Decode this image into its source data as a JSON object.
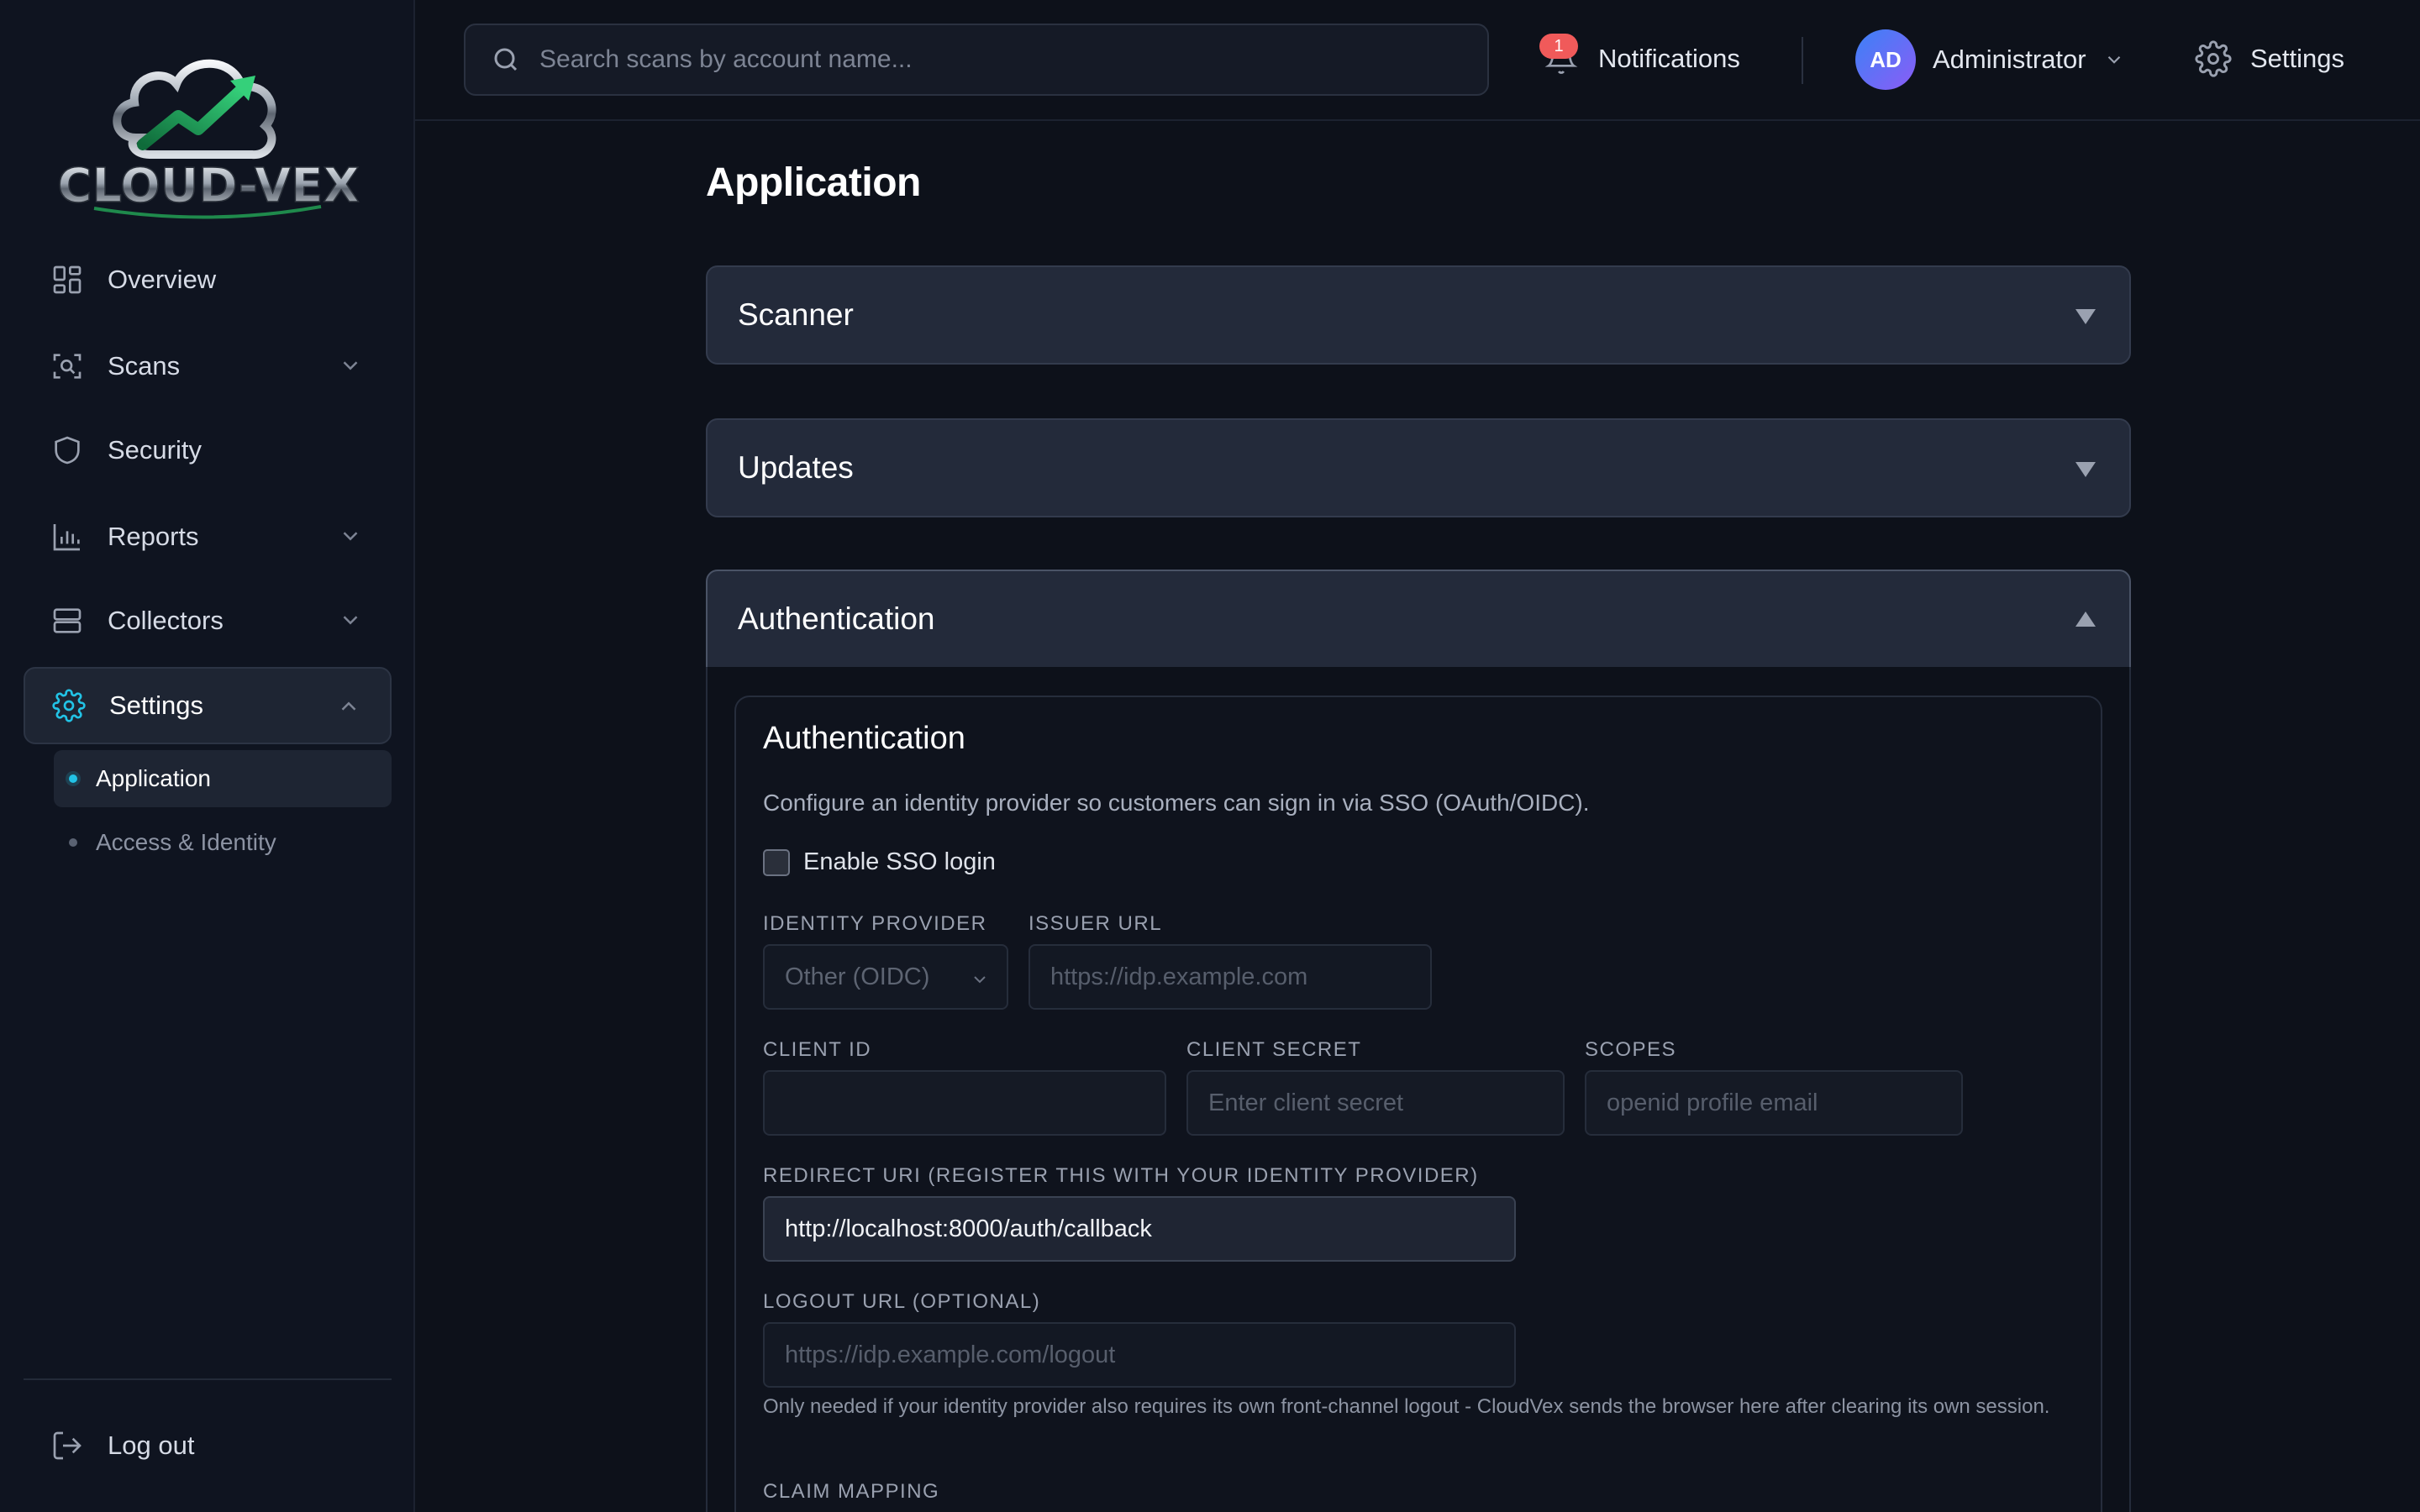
{
  "brand": {
    "name": "CLOUD-VEX"
  },
  "sidebar": {
    "items": [
      {
        "label": "Overview",
        "icon": "grid-icon"
      },
      {
        "label": "Scans",
        "icon": "scan-icon"
      },
      {
        "label": "Security",
        "icon": "shield-icon"
      },
      {
        "label": "Reports",
        "icon": "bar-chart-icon"
      },
      {
        "label": "Collectors",
        "icon": "server-icon"
      },
      {
        "label": "Settings",
        "icon": "gear-icon"
      }
    ],
    "sub_items": [
      {
        "label": "Application"
      },
      {
        "label": "Access & Identity"
      }
    ],
    "logout": "Log out"
  },
  "topbar": {
    "search_placeholder": "Search scans by account name...",
    "notifications_label": "Notifications",
    "notifications_count": "1",
    "user_initials": "AD",
    "user_name": "Administrator",
    "settings_label": "Settings"
  },
  "main": {
    "title": "Application",
    "sections": [
      {
        "title": "Scanner",
        "expanded": false
      },
      {
        "title": "Updates",
        "expanded": false
      },
      {
        "title": "Authentication",
        "expanded": true
      }
    ],
    "auth": {
      "card_title": "Authentication",
      "description": "Configure an identity provider so customers can sign in via SSO (OAuth/OIDC).",
      "enable_sso_label": "Enable SSO login",
      "enable_sso_checked": false,
      "identity_provider_label": "IDENTITY PROVIDER",
      "identity_provider_value": "Other (OIDC)",
      "issuer_url_label": "ISSUER URL",
      "issuer_url_placeholder": "https://idp.example.com",
      "client_id_label": "CLIENT ID",
      "client_id_value": "",
      "client_secret_label": "CLIENT SECRET",
      "client_secret_placeholder": "Enter client secret",
      "scopes_label": "SCOPES",
      "scopes_placeholder": "openid profile email",
      "redirect_uri_label": "REDIRECT URI (REGISTER THIS WITH YOUR IDENTITY PROVIDER)",
      "redirect_uri_value": "http://localhost:8000/auth/callback",
      "logout_url_label": "LOGOUT URL (OPTIONAL)",
      "logout_url_placeholder": "https://idp.example.com/logout",
      "logout_hint": "Only needed if your identity provider also requires its own front-channel logout - CloudVex sends the browser here after clearing its own session.",
      "claim_mapping_label": "CLAIM MAPPING"
    }
  },
  "colors": {
    "accent": "#22c3e6",
    "badge": "#f05a5a",
    "background": "#0d111a",
    "sidebar": "#0f1420",
    "accordion": "#232a3a"
  }
}
